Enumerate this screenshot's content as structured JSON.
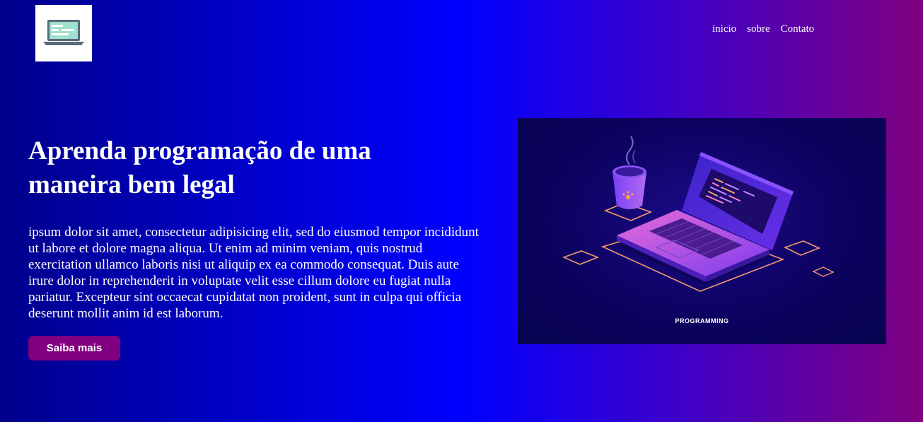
{
  "header": {
    "logo_icon": "laptop-icon",
    "nav": [
      {
        "label": "inicio"
      },
      {
        "label": "sobre"
      },
      {
        "label": "Contato"
      }
    ]
  },
  "hero": {
    "title": "Aprenda programação de uma maneira bem legal",
    "text": "ipsum dolor sit amet, consectetur adipisicing elit, sed do eiusmod tempor incididunt ut labore et dolore magna aliqua. Ut enim ad minim veniam, quis nostrud exercitation ullamco laboris nisi ut aliquip ex ea commodo consequat. Duis aute irure dolor in reprehenderit in voluptate velit esse cillum dolore eu fugiat nulla pariatur. Excepteur sint occaecat cupidatat non proident, sunt in culpa qui officia deserunt mollit anim id est laborum.",
    "cta_label": "Saiba mais"
  },
  "illustration": {
    "caption": "PROGRAMMING",
    "icon": "isometric-laptop-illustration"
  },
  "colors": {
    "gradient_start": "#00008b",
    "gradient_mid": "#0000ff",
    "gradient_end": "#800080",
    "button": "#800080"
  }
}
